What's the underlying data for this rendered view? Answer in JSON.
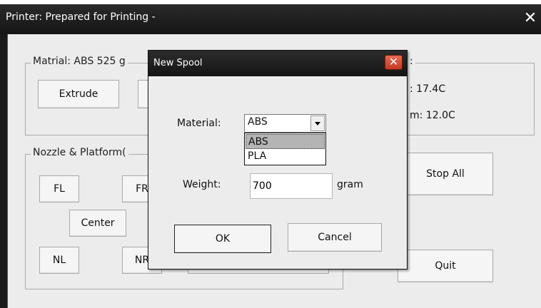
{
  "main_window": {
    "title": "Printer: Prepared for Printing -",
    "close_glyph": "✕",
    "material_group": {
      "title": "Matrial: ABS 525 g",
      "extrude_label": "Extrude"
    },
    "temp_group": {
      "title_suffix": ":",
      "nozzle_temp": ": 17.4C",
      "platform_temp": "m: 12.0C"
    },
    "nozzle_group": {
      "title": "Nozzle & Platform(",
      "fl_label": "FL",
      "fr_label": "FR",
      "center_label": "Center",
      "nl_label": "NL",
      "nr_label": "NR"
    },
    "stop_all_label": "Stop All",
    "quit_label": "Quit"
  },
  "dialog": {
    "title": "New Spool",
    "close_glyph": "✕",
    "material_label": "Material:",
    "material_value": "ABS",
    "material_options": [
      "ABS",
      "PLA"
    ],
    "weight_label": "Weight:",
    "weight_value": "700",
    "weight_unit": "gram",
    "ok_label": "OK",
    "cancel_label": "Cancel"
  },
  "colors": {
    "titlebar": "#1a1a1a",
    "close_red": "#d4472d",
    "client_bg": "#ececec"
  }
}
